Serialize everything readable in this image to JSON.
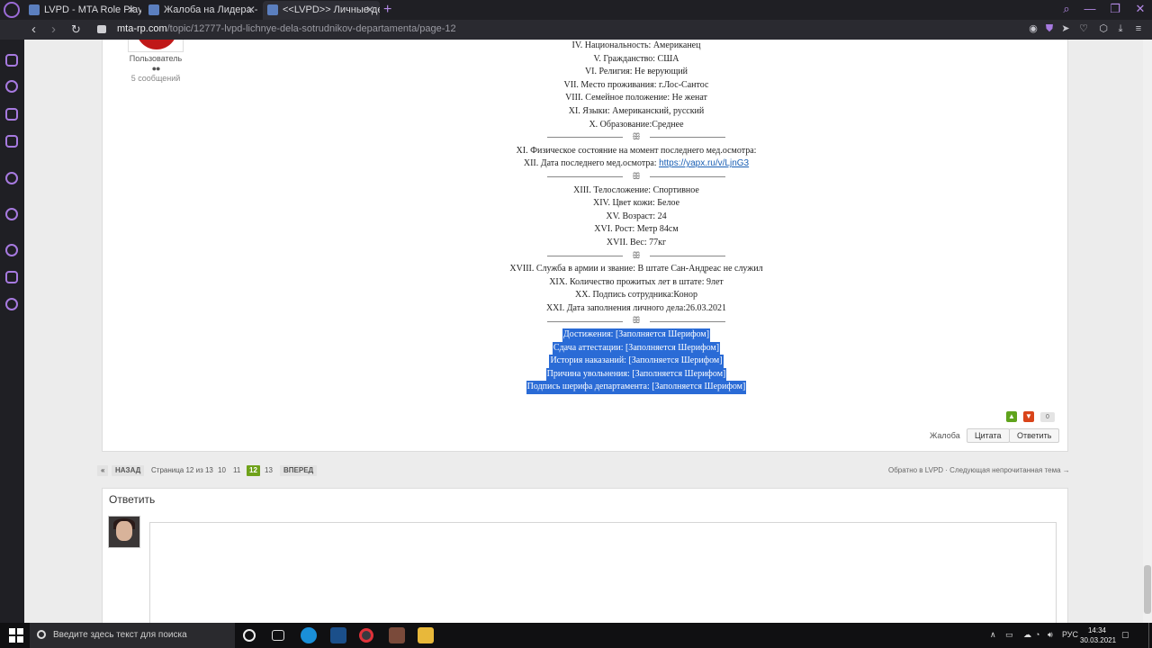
{
  "browser": {
    "tabs": [
      {
        "title": "LVPD - MTA Role Play",
        "active": false
      },
      {
        "title": "Жалоба на Лидера - Стра",
        "active": false
      },
      {
        "title": "<<LVPD>> Личные дела с",
        "active": true
      }
    ],
    "url_domain": "mta-rp.com",
    "url_path": "/topic/12777-lvpd-lichnye-dela-sotrudnikov-departamenta/page-12",
    "accent": "#a77ae0"
  },
  "post": {
    "author_role": "Пользователь",
    "author_rank_pips": "●●",
    "author_posts": "5 сообщений",
    "lines": [
      "IV. Национальность: Американец",
      "V. Гражданство: США",
      "VI. Религия: Не верующий",
      "VII. Место проживания: г.Лос-Сантос",
      "VIII. Семейное положение: Не женат",
      "XI. Языки: Американский, русский",
      "X. Образование:Среднее"
    ],
    "divider": "ꕥ",
    "health_line": "XI. Физическое состояние на момент последнего мед.осмотра:",
    "medical_date_label": "XII. Дата последнего мед.осмотра: ",
    "medical_link": "https://yapx.ru/v/LjnG3",
    "body_lines": [
      "XIII. Телосложение: Спортивное",
      "XIV. Цвет кожи: Белое",
      "XV. Возраст: 24",
      "XVI. Рост: Метр 84см",
      "XVII. Вес: 77кг"
    ],
    "service_lines": [
      "XVIII. Служба в армии и звание: В штате Сан-Андреас не служил",
      "XIX. Количество прожитых лет в штате: 9лет",
      "XX. Подпись сотрудника:Конор",
      "XXI. Дата заполнения личного дела:26.03.2021"
    ],
    "sheriff_lines": [
      "Достижения: [Заполняется Шерифом]",
      "Сдача аттестации: [Заполняется Шерифом]",
      "История наказаний: [Заполняется Шерифом]",
      "Причина увольнения: [Заполняется Шерифом]",
      "Подпись шерифа департамента: [Заполняется Шерифом]"
    ],
    "rating": "0",
    "report_label": "Жалоба",
    "quote_label": "Цитата",
    "reply_label": "Ответить"
  },
  "pagination": {
    "first": "«",
    "prev": "НАЗАД",
    "info": "Страница 12 из 13",
    "pages": [
      "10",
      "11",
      "12",
      "13"
    ],
    "current": "12",
    "next": "ВПЕРЕД",
    "back_links": "Обратно в LVPD · Следующая непрочитанная тема →"
  },
  "reply": {
    "title": "Ответить"
  },
  "taskbar": {
    "search_placeholder": "Введите здесь текст для поиска",
    "lang": "РУС",
    "time": "14:34",
    "date": "30.03.2021"
  }
}
